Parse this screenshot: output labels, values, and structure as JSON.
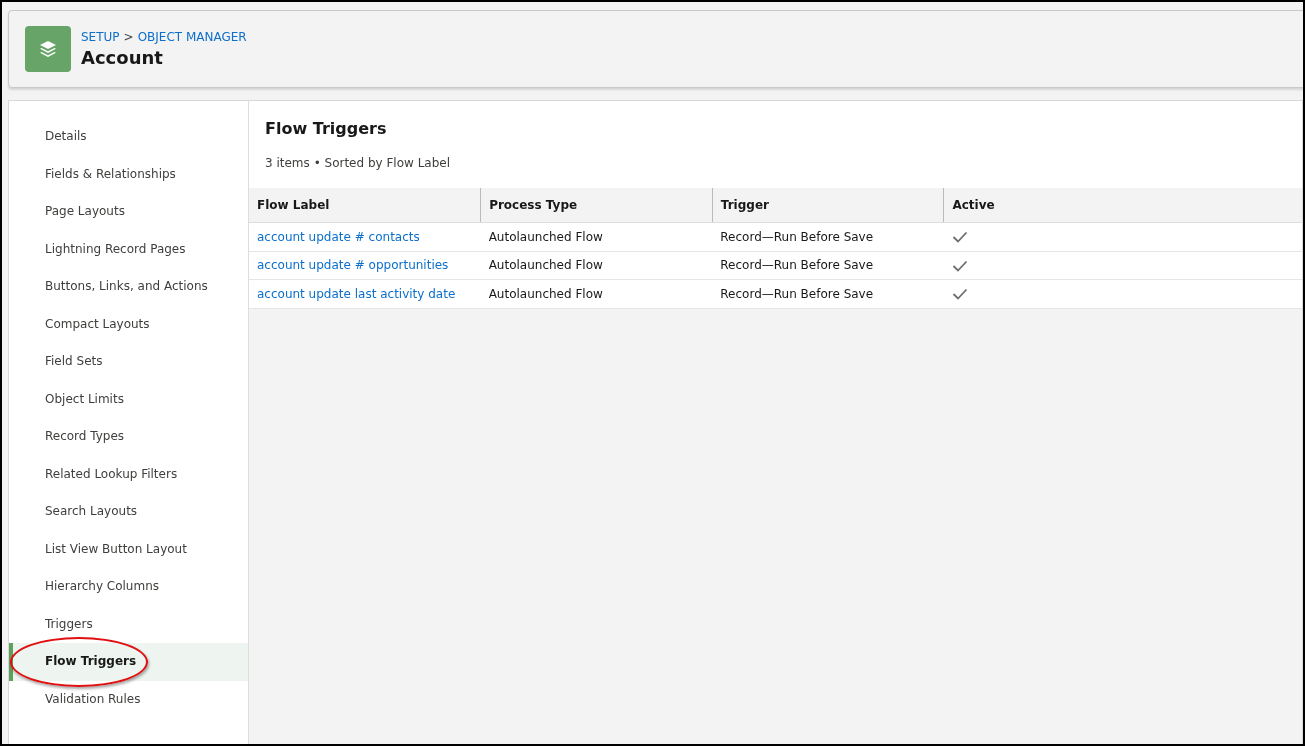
{
  "header": {
    "breadcrumbs": [
      "SETUP",
      "OBJECT MANAGER"
    ],
    "breadcrumb_separator": ">",
    "title": "Account"
  },
  "sidebar": {
    "items": [
      {
        "label": "Details",
        "selected": false,
        "circled": false
      },
      {
        "label": "Fields & Relationships",
        "selected": false,
        "circled": false
      },
      {
        "label": "Page Layouts",
        "selected": false,
        "circled": false
      },
      {
        "label": "Lightning Record Pages",
        "selected": false,
        "circled": false
      },
      {
        "label": "Buttons, Links, and Actions",
        "selected": false,
        "circled": false
      },
      {
        "label": "Compact Layouts",
        "selected": false,
        "circled": false
      },
      {
        "label": "Field Sets",
        "selected": false,
        "circled": false
      },
      {
        "label": "Object Limits",
        "selected": false,
        "circled": false
      },
      {
        "label": "Record Types",
        "selected": false,
        "circled": false
      },
      {
        "label": "Related Lookup Filters",
        "selected": false,
        "circled": false
      },
      {
        "label": "Search Layouts",
        "selected": false,
        "circled": false
      },
      {
        "label": "List View Button Layout",
        "selected": false,
        "circled": false
      },
      {
        "label": "Hierarchy Columns",
        "selected": false,
        "circled": false
      },
      {
        "label": "Triggers",
        "selected": false,
        "circled": false
      },
      {
        "label": "Flow Triggers",
        "selected": true,
        "circled": true
      },
      {
        "label": "Validation Rules",
        "selected": false,
        "circled": false
      }
    ]
  },
  "content": {
    "title": "Flow Triggers",
    "summary": "3 items • Sorted by Flow Label",
    "table": {
      "columns": [
        "Flow Label",
        "Process Type",
        "Trigger",
        "Active"
      ],
      "rows": [
        {
          "flow_label": "account update # contacts",
          "process_type": "Autolaunched Flow",
          "trigger": "Record—Run Before Save",
          "active": true
        },
        {
          "flow_label": "account update # opportunities",
          "process_type": "Autolaunched Flow",
          "trigger": "Record—Run Before Save",
          "active": true
        },
        {
          "flow_label": "account update last activity date",
          "process_type": "Autolaunched Flow",
          "trigger": "Record—Run Before Save",
          "active": true
        }
      ]
    }
  }
}
